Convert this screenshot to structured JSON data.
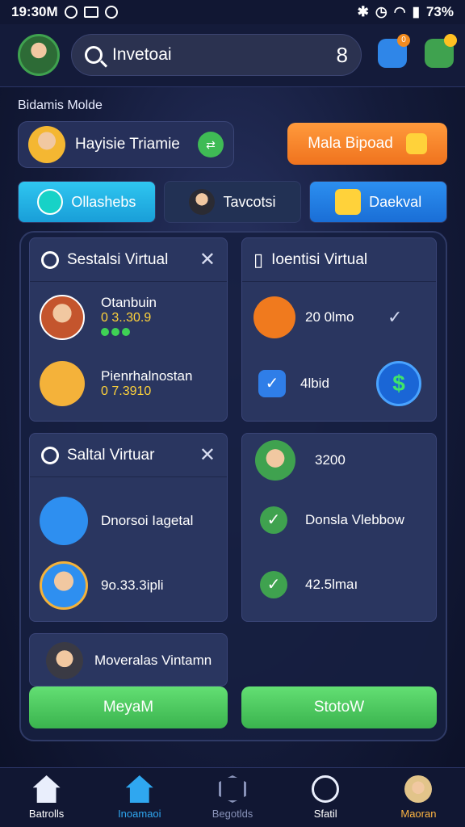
{
  "status_bar": {
    "time": "19:30M",
    "battery": "73%"
  },
  "header": {
    "search_query": "Invetoai",
    "search_badge": "8",
    "notif_count": "0"
  },
  "section_title": "Bidamis Molde",
  "profile": {
    "name": "Hayisie Triamie",
    "chip": "⇄"
  },
  "primary_action": {
    "label": "Mala Bipoad"
  },
  "tabs": [
    {
      "label": "Ollashebs"
    },
    {
      "label": "Tavcotsi"
    },
    {
      "label": "Daekval"
    }
  ],
  "cards": {
    "top_left": {
      "title": "Sestalsi Virtual",
      "items": [
        {
          "line1": "Otanbuin",
          "line2": "0 3..30.9"
        },
        {
          "line1": "Pienrhalnostan",
          "line2": "0 7.3910"
        }
      ]
    },
    "top_right": {
      "title": "Ioentisi Virtual",
      "items": [
        {
          "line1": "20 0lmo"
        },
        {
          "line1": "4lbid"
        }
      ]
    },
    "mid_left": {
      "title": "Saltal Virtuar",
      "items": [
        {
          "line1": "Dnorsoi Iagetal"
        },
        {
          "line1": "9o.33.3ipli"
        }
      ]
    },
    "mid_right": {
      "items": [
        {
          "line1": "3200"
        },
        {
          "line1": "Donsla Vlebbow"
        },
        {
          "line1": "42.5lmaı"
        }
      ]
    },
    "bottom_left": {
      "title": "Moveralas Vintamn"
    }
  },
  "buttons": {
    "left": "MeyaM",
    "right": "StotoW"
  },
  "bottom_nav": [
    {
      "label": "Batrolls"
    },
    {
      "label": "Inoamaoi"
    },
    {
      "label": "Begotlds"
    },
    {
      "label": "Sfatil"
    },
    {
      "label": "Maoran"
    }
  ],
  "colors": {
    "accent_orange": "#f0731e",
    "accent_green": "#3ab34e",
    "accent_blue": "#2fa7f0",
    "background": "#141b3a"
  }
}
